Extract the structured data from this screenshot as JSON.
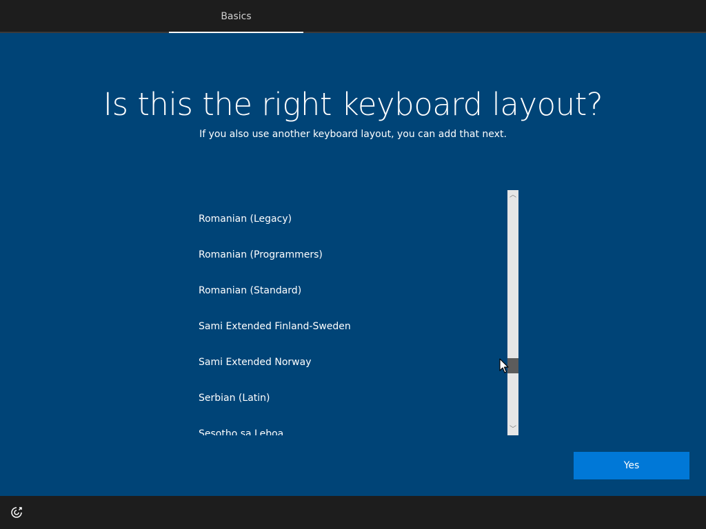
{
  "header": {
    "tabs": [
      {
        "label": "Basics",
        "active": true
      }
    ]
  },
  "main": {
    "title": "Is this the right keyboard layout?",
    "subtitle": "If you also use another keyboard layout, you can add that next.",
    "layouts": [
      "Romanian (Legacy)",
      "Romanian (Programmers)",
      "Romanian (Standard)",
      "Sami Extended Finland-Sweden",
      "Sami Extended Norway",
      "Serbian (Latin)",
      "Sesotho sa Leboa"
    ],
    "scrollbar": {
      "up_arrow": "︿",
      "down_arrow": "﹀"
    }
  },
  "actions": {
    "yes_label": "Yes"
  },
  "footer": {
    "accessibility_icon": "ease-of-access-icon"
  },
  "colors": {
    "background": "#004477",
    "top_bar": "#1d1d1d",
    "accent_button": "#0078d7",
    "text": "#ffffff"
  }
}
